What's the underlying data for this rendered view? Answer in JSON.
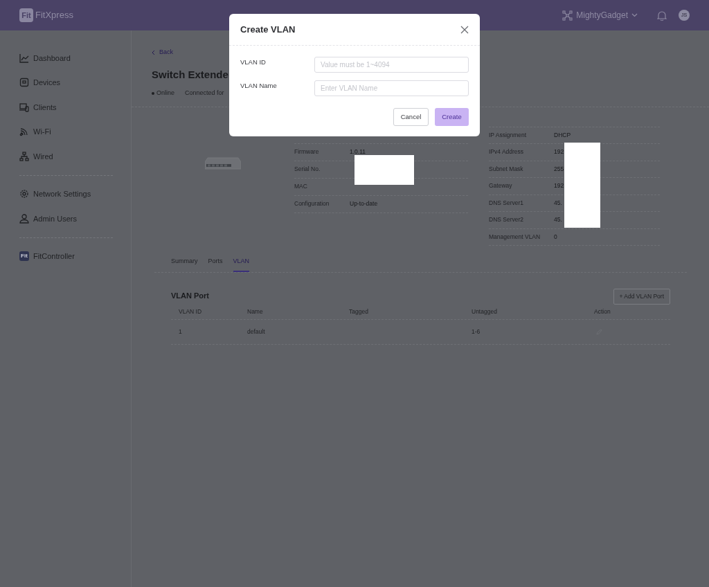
{
  "header": {
    "logo_mark": "Fit",
    "app_name": "FitXpress",
    "site": "MightyGadget",
    "avatar": "JS"
  },
  "sidebar": {
    "groups": [
      [
        {
          "label": "Dashboard"
        },
        {
          "label": "Devices"
        },
        {
          "label": "Clients"
        },
        {
          "label": "Wi-Fi"
        },
        {
          "label": "Wired"
        }
      ],
      [
        {
          "label": "Network Settings"
        },
        {
          "label": "Admin Users"
        }
      ],
      [
        {
          "label": "FitController",
          "mark": "Fit"
        }
      ]
    ]
  },
  "device": {
    "back": "Back",
    "title": "Switch Extende",
    "status": "Online",
    "connected": "Connected for",
    "info_left": [
      {
        "label": "Firmware",
        "value": "1.0.11"
      },
      {
        "label": "Serial No."
      },
      {
        "label": "MAC"
      },
      {
        "label": "Configuration",
        "value": "Up-to-date"
      }
    ],
    "info_right": [
      {
        "label": "IP Assignment",
        "value": "DHCP"
      },
      {
        "label": "IPv4 Address",
        "value": "192"
      },
      {
        "label": "Subnet Mask",
        "value": "255"
      },
      {
        "label": "Gateway",
        "value": "192"
      },
      {
        "label": "DNS Server1",
        "value": "45."
      },
      {
        "label": "DNS Server2",
        "value": "45."
      },
      {
        "label": "Management VLAN",
        "value": "0"
      }
    ]
  },
  "tabs": [
    {
      "label": "Summary",
      "selected": false
    },
    {
      "label": "Ports",
      "selected": false
    },
    {
      "label": "VLAN",
      "selected": true
    }
  ],
  "vlan_port": {
    "title": "VLAN Port",
    "add_button": "+ Add VLAN Port",
    "columns": [
      "VLAN ID",
      "Name",
      "Tagged",
      "Untagged",
      "Action"
    ],
    "rows": [
      {
        "vlan_id": "1",
        "name": "default",
        "untagged": "1-6"
      }
    ]
  },
  "dialog": {
    "title": "Create VLAN",
    "fields": [
      {
        "label": "VLAN ID",
        "placeholder": "Value must be 1~4094"
      },
      {
        "label": "VLAN Name",
        "placeholder": "Enter VLAN Name"
      }
    ],
    "buttons": [
      {
        "label": "Cancel",
        "kind": "secondary",
        "disabled": false
      },
      {
        "label": "Create",
        "kind": "primary",
        "disabled": true
      }
    ]
  }
}
